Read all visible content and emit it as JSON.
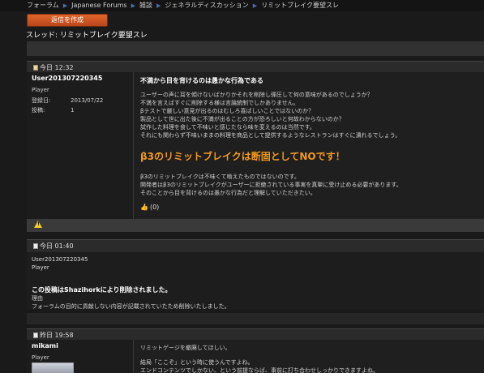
{
  "breadcrumb": {
    "items": [
      "フォーラム",
      "Japanese Forums",
      "雑談",
      "ジェネラルディスカッション",
      "リミットブレイク要望スレ"
    ]
  },
  "toolbar": {
    "reply_label": "返信を作成"
  },
  "thread": {
    "title_prefix": "スレッド:",
    "title": "リミットブレイク要望スレ"
  },
  "posts": [
    {
      "date": "今日 12:32",
      "user": {
        "name": "User201307220345",
        "role": "Player",
        "joined_label": "登録日:",
        "joined_value": "2013/07/22",
        "posts_label": "投稿:",
        "posts_value": "1"
      },
      "title": "不満から目を背けるのは愚かな行為である",
      "lines": [
        "ユーザーの声に耳を傾けないばかりかそれを削除し弾圧して何の意味があるのでしょうか？",
        "不満を言えばすぐに削除する様は言論統制でしかありません。",
        "βテストで厳しい意見が出るのはむしろ喜ばしいことではないのか？",
        "製品として世に出た後に不満が出ることの方が恐ろしいと何故わからないのか？",
        "試作した料理を食して不味いと感じたなら味を変えるのは当然です。",
        "それにも関わらず不味いままの料理を商品として提供するようなレストランはすぐに潰れるでしょう。"
      ],
      "emphasis": "β3のリミットブレイクは断固としてNOです！",
      "lines2": [
        "β3のリミットブレイクは不味くて喰えたものではないのです。",
        "開発者はβ3のリミットブレイクがユーザーに拒絶されている事実を真摯に受け止める必要があります。",
        "そのことから目を背けるのは愚かな行為だと理解していただきたい。"
      ],
      "likes": "(0)"
    },
    {
      "date": "今日  01:40",
      "user": {
        "name": "User201307220345",
        "role": "Player"
      },
      "deleted_title": "この投稿はShazihorkにより削除されました。",
      "reason_label": "理由",
      "reason": "フォーラムの目的に貢献しない内容が記載されていたため削除いたしました。"
    },
    {
      "date": "昨日 19:58",
      "user": {
        "name": "mikami",
        "role": "Player"
      },
      "lines": [
        "リミットゲージを撤廃してほしい。",
        "結局「ここぞ」という時に使うんですよね。",
        "エンドコンテンツでしかない、という前提ならば、事前に打ち合わせしっかりできますよね。"
      ]
    }
  ],
  "colors": {
    "accent": "#f39a19",
    "button": "#c9521e",
    "background": "#1a1a1a"
  }
}
